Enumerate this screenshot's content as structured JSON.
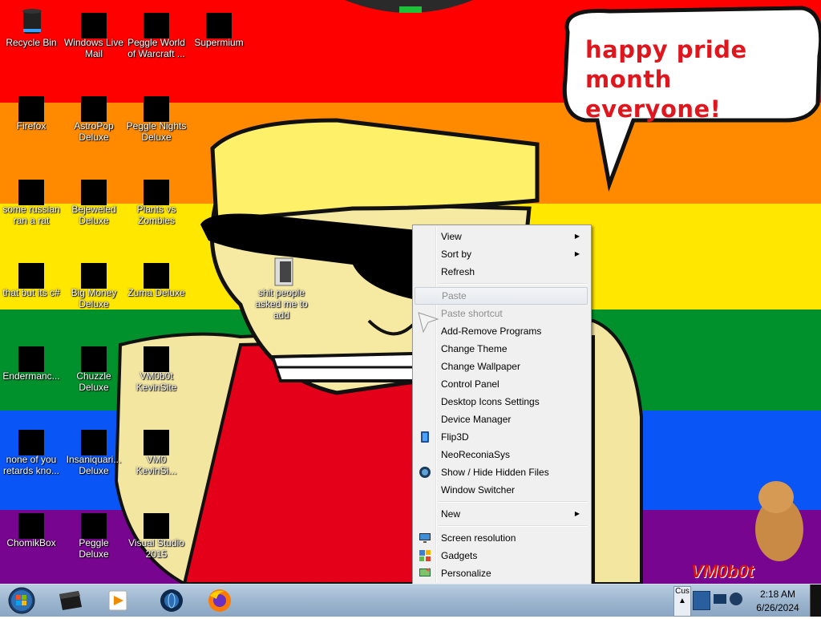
{
  "desktop": {
    "icons": [
      {
        "label": "Recycle Bin"
      },
      {
        "label": "Windows Live Mail"
      },
      {
        "label": "Peggle World of Warcraft ..."
      },
      {
        "label": "Supermium"
      },
      {
        "label": "Firefox"
      },
      {
        "label": "AstroPop Deluxe"
      },
      {
        "label": "Peggle Nights Deluxe"
      },
      {
        "label": "some russian ran a rat"
      },
      {
        "label": "Bejeweled Deluxe"
      },
      {
        "label": "Plants vs Zombies"
      },
      {
        "label": "that but its c#"
      },
      {
        "label": "Big Money Deluxe"
      },
      {
        "label": "Zuma Deluxe"
      },
      {
        "label": "Endermanc..."
      },
      {
        "label": "Chuzzle Deluxe"
      },
      {
        "label": "VM0b0t KevinSite"
      },
      {
        "label": "none of you retards kno..."
      },
      {
        "label": "Insaniquari... Deluxe"
      },
      {
        "label": "VM0 KevinSi..."
      },
      {
        "label": "ChomikBox"
      },
      {
        "label": "Peggle Deluxe"
      },
      {
        "label": "Visual Studio 2015"
      },
      {
        "label": "shit people asked me to add"
      }
    ],
    "bubble_line1": "happy pride month",
    "bubble_line2": "everyone!",
    "watermark": "VM0b0t"
  },
  "context_menu": {
    "items": [
      {
        "label": "View",
        "submenu": true
      },
      {
        "label": "Sort by",
        "submenu": true
      },
      {
        "label": "Refresh"
      },
      {
        "label": "Paste",
        "disabled": true
      },
      {
        "label": "Paste shortcut",
        "disabled": true
      },
      {
        "label": "Add-Remove Programs"
      },
      {
        "label": "Change Theme"
      },
      {
        "label": "Change Wallpaper"
      },
      {
        "label": "Control Panel"
      },
      {
        "label": "Desktop Icons Settings"
      },
      {
        "label": "Device Manager"
      },
      {
        "label": "Flip3D",
        "icon": "flip3d-icon"
      },
      {
        "label": "NeoReconiaSys"
      },
      {
        "label": "Show / Hide Hidden Files",
        "icon": "globe-icon"
      },
      {
        "label": "Window Switcher"
      },
      {
        "label": "New",
        "submenu": true
      },
      {
        "label": "Screen resolution",
        "icon": "monitor-icon"
      },
      {
        "label": "Gadgets",
        "icon": "gadgets-icon"
      },
      {
        "label": "Personalize",
        "icon": "personalize-icon"
      }
    ]
  },
  "taskbar": {
    "start_icon": "windows-orb-icon",
    "pinned": [
      "terminal-icon",
      "media-player-icon",
      "globe-browser-icon",
      "firefox-icon"
    ],
    "tray_label": "Cus",
    "clock_time": "2:18 AM",
    "clock_date": "6/26/2024"
  },
  "colors": {
    "red": "#fe0000",
    "orange": "#ff8a00",
    "yellow": "#ffe700",
    "green": "#00912c",
    "blue": "#0a55f5",
    "purple": "#77058f",
    "bubble_text": "#e0161e"
  }
}
